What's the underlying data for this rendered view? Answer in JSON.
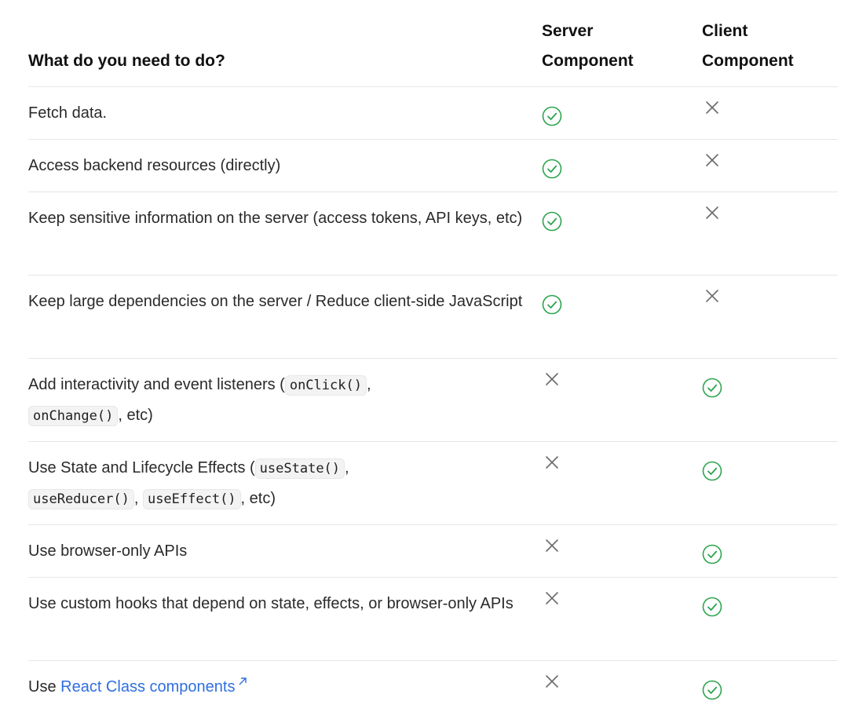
{
  "table": {
    "headers": {
      "task": "What do you need to do?",
      "server_line1": "Server",
      "server_line2": "Component",
      "client_line1": "Client",
      "client_line2": "Component"
    },
    "rows": [
      {
        "text1": "Fetch data.",
        "server": "check",
        "client": "cross"
      },
      {
        "text1": "Access backend resources (directly)",
        "server": "check",
        "client": "cross"
      },
      {
        "text1": "Keep sensitive information on the server (access tokens, API keys, etc)",
        "server": "check",
        "client": "cross"
      },
      {
        "text1": "Keep large dependencies on the server / Reduce client-side JavaScript",
        "server": "check",
        "client": "cross"
      },
      {
        "text1": "Add interactivity and event listeners (",
        "code1": "onClick()",
        "text2": ",",
        "code2": "onChange()",
        "text3": ", etc)",
        "server": "cross",
        "client": "check"
      },
      {
        "text1": "Use State and Lifecycle Effects (",
        "code1": "useState()",
        "text2": ",",
        "code2": "useReducer()",
        "text3": ",",
        "code3": "useEffect()",
        "text4": ", etc)",
        "server": "cross",
        "client": "check"
      },
      {
        "text1": "Use browser-only APIs",
        "server": "cross",
        "client": "check"
      },
      {
        "text1": "Use custom hooks that depend on state, effects, or browser-only APIs",
        "server": "cross",
        "client": "check"
      },
      {
        "text1": "Use ",
        "link": "React Class components",
        "server": "cross",
        "client": "check"
      }
    ]
  },
  "colors": {
    "check": "#2da44e",
    "cross": "#6b6b6b",
    "link": "#2f6fe0",
    "divider": "#e6e6e6"
  },
  "icons": {
    "check": "check-circle-icon",
    "cross": "x-icon",
    "external": "external-link-icon"
  }
}
